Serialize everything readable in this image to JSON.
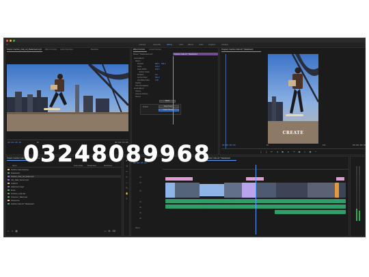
{
  "app": {
    "home_icon": "home-icon"
  },
  "workspaces": [
    "Learning",
    "Assembly",
    "Editing",
    "Color",
    "Effects",
    "Audio",
    "Graphics",
    "Libraries"
  ],
  "source": {
    "tab": "Source: Fashion_Cafe_Ad_Skateboard.mp4",
    "other_tabs": [
      "Effect Controls",
      "Audio Clip Mixer",
      "Metadata"
    ],
    "timecode": "00:00:03:16",
    "fit": "Fit",
    "duration": "00:00:10:05"
  },
  "effect_controls": {
    "tab": "Effect Controls",
    "other_tabs": [
      "Lumetri Scopes",
      "Audio Clip Mixer"
    ],
    "clip_label": "Master * Skateboard.mp4",
    "sequence_label": "Fashion Cafe Ad * Skateboard",
    "rows": [
      "Video Effects",
      "Motion",
      "Position",
      "Scale",
      "Scale Width",
      "Uniform Scale",
      "Rotation",
      "Anchor Point",
      "Anti-flicker Filter",
      "Opacity",
      "Time Remapping",
      "Audio Effects",
      "Volume",
      "Channel Volume",
      "Panner"
    ],
    "values": [
      "960.0",
      "540.0",
      "100.0",
      "100.0",
      "0.0",
      "960.0",
      "0.00"
    ],
    "reset_label": "Reset",
    "preset_label": "Default",
    "presets": [
      "Save Preset...",
      "Import Presets..."
    ]
  },
  "program": {
    "tab": "Program: Fashion Cafe Ad * Skateboard",
    "timecode": "00:00:05:01",
    "fit": "Fit",
    "scale": "Full",
    "duration": "00:00:20:06",
    "overlay_text": "CREATE"
  },
  "project": {
    "tab": "Project: Fashion Cafe Ad",
    "other_tabs": [
      "Media Browser",
      "Libraries"
    ],
    "items": [
      {
        "name": "Fashion Cafe Ad.prproj",
        "color": "#e7c34a"
      },
      {
        "name": "Skateboard",
        "color": "#3fb06b"
      },
      {
        "name": "Fashion_Cafe_Ad_Skate.mp4",
        "color": "#8a6be0"
      },
      {
        "name": "City_Walk_Sunset.mp4",
        "color": "#8a6be0"
      },
      {
        "name": "Graphics",
        "color": "#e7c34a"
      },
      {
        "name": "Adjustment Layer",
        "color": "#8a6be0"
      },
      {
        "name": "Music",
        "color": "#3fb06b"
      },
      {
        "name": "Ambient_Loop.wav",
        "color": "#3fb06b"
      },
      {
        "name": "Voiceover_Take2.wav",
        "color": "#3fb06b"
      },
      {
        "name": "Sequences",
        "color": "#e7c34a"
      },
      {
        "name": "Fashion Cafe Ad * Skateboard",
        "color": "#3fb06b"
      }
    ],
    "columns": [
      "Name",
      "Frame Rate",
      "Media Start",
      "Media End"
    ]
  },
  "timeline": {
    "tab": "Fashion Cafe Ad * Skateboard",
    "timecode": "00:00:05:01",
    "tracks": [
      "V3",
      "V2",
      "V1",
      "A1",
      "A2",
      "A3",
      "A4",
      "Master"
    ]
  },
  "overlay_number": "03248089968",
  "colors": {
    "accent": "#5da0ff",
    "panel": "#1b1b1b",
    "pink_clip": "#e59ad8",
    "blue_clip": "#8fb4e8",
    "purple_clip": "#b9a4ec",
    "audio_clip": "#2f9e68",
    "orange_clip": "#e49a3c"
  }
}
